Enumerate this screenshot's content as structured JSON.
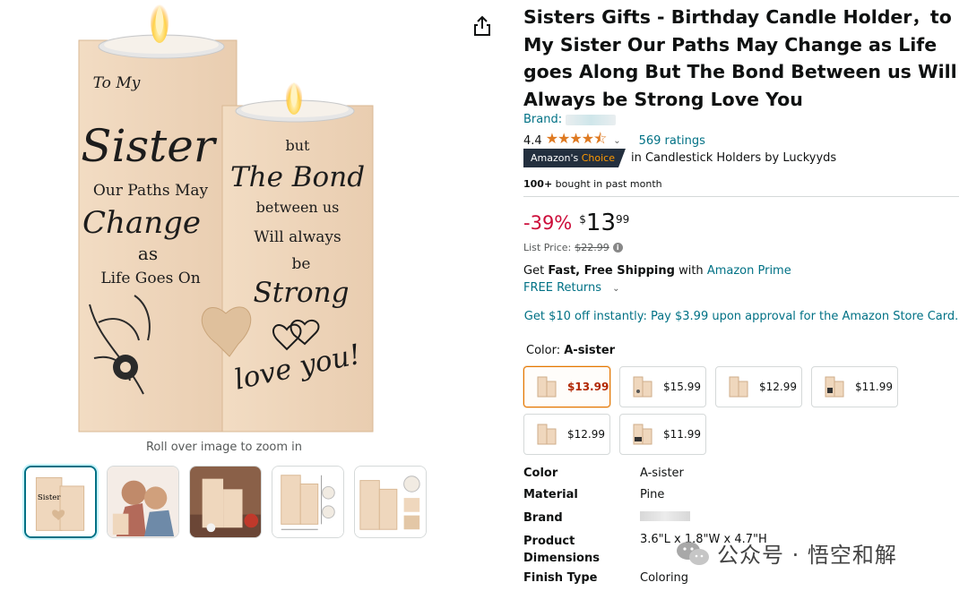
{
  "gallery": {
    "zoom_hint": "Roll over image to zoom in",
    "product_text": {
      "left_block": [
        "To My",
        "Sister",
        "Our Paths May",
        "Change",
        "as",
        "Life Goes On"
      ],
      "right_block": [
        "but",
        "The Bond",
        "between us",
        "Will always",
        "be",
        "Strong",
        "love you!"
      ]
    },
    "thumbnails": [
      "thumb-1",
      "thumb-2",
      "thumb-3",
      "thumb-4",
      "thumb-5"
    ]
  },
  "product": {
    "title": "Sisters Gifts - Birthday Candle Holder，to My Sister Our Paths May Change as Life goes Along But The Bond Between us Will Always be Strong Love You",
    "brand_label": "Brand:",
    "rating_value": "4.4",
    "stars": "★★★★⯪",
    "ratings_count": "569 ratings",
    "badge_main": "Amazon's",
    "badge_accent": "Choice",
    "choice_category": "in Candlestick Holders by Luckyyds",
    "bought_bold": "100+",
    "bought_rest": " bought in past month",
    "discount": "-39%",
    "price_symbol": "$",
    "price_whole": "13",
    "price_fraction": "99",
    "list_price_label": "List Price:",
    "list_price": "$22.99",
    "shipping_prefix": "Get ",
    "shipping_bold": "Fast, Free Shipping",
    "shipping_with": " with ",
    "shipping_prime": "Amazon Prime",
    "returns": "FREE Returns",
    "promo": "Get $10 off instantly: Pay $3.99 upon approval for the Amazon Store Card.",
    "color_label": "Color: ",
    "color_value": "A-sister",
    "swatches": [
      {
        "price": "$13.99"
      },
      {
        "price": "$15.99"
      },
      {
        "price": "$12.99"
      },
      {
        "price": "$11.99"
      },
      {
        "price": "$12.99"
      },
      {
        "price": "$11.99"
      }
    ],
    "specs": [
      {
        "key": "Color",
        "value": "A-sister"
      },
      {
        "key": "Material",
        "value": "Pine"
      },
      {
        "key": "Brand",
        "value": ""
      },
      {
        "key": "Product Dimensions",
        "value": "3.6\"L x 1.8\"W x 4.7\"H"
      },
      {
        "key": "Finish Type",
        "value": "Coloring"
      }
    ]
  },
  "watermark": "公众号 · 悟空和解",
  "colors": {
    "link": "#007185",
    "discount": "#cc0c39",
    "star": "#de7921",
    "badge_bg": "#232f3e",
    "badge_accent": "#ff9900",
    "wood": "#efd7bd"
  },
  "icons": {
    "share": "share-icon",
    "info": "info-icon",
    "chevron": "chevron-down-icon"
  }
}
